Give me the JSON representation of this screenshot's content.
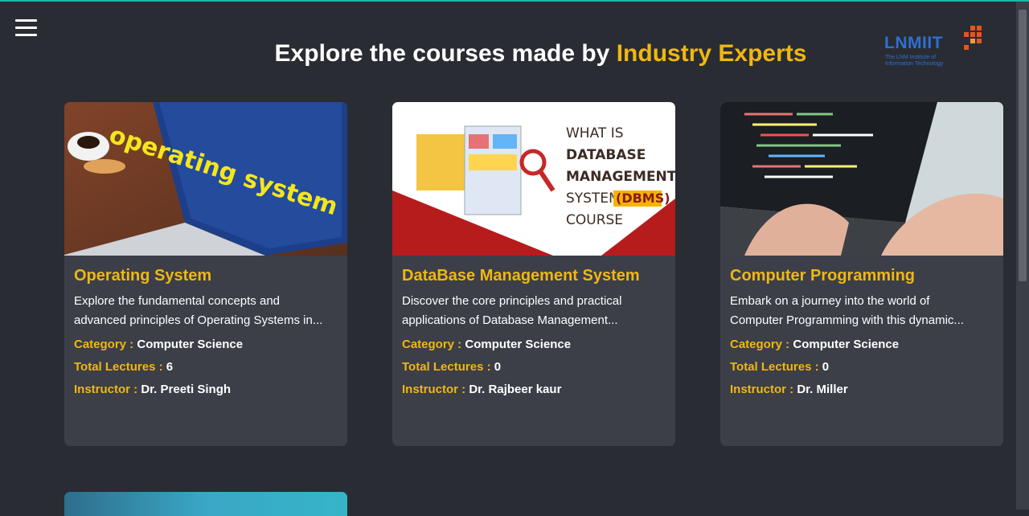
{
  "header": {
    "title_prefix": "Explore the courses made by ",
    "title_highlight": "Industry Experts",
    "logo_text": "LNMIIT",
    "logo_sub_line1": "The LNM Institute of",
    "logo_sub_line2": "Information Technology"
  },
  "labels": {
    "category": "Category : ",
    "lectures": "Total Lectures : ",
    "instructor": "Instructor : "
  },
  "image_text": {
    "os_words": "operating system",
    "dbms_line1": "WHAT IS",
    "dbms_line2": "DATABASE",
    "dbms_line3": "MANAGEMENT",
    "dbms_line4": "SYSTEM",
    "dbms_line4b": "(DBMS)",
    "dbms_line5": "COURSE"
  },
  "courses": [
    {
      "title": "Operating System",
      "desc1": "Explore the fundamental concepts and",
      "desc2": "advanced principles of Operating Systems in...",
      "category": "Computer Science",
      "lectures": "6",
      "instructor": "Dr. Preeti Singh"
    },
    {
      "title": "DataBase Management System",
      "desc1": "Discover the core principles and practical",
      "desc2": "applications of Database Management...",
      "category": "Computer Science",
      "lectures": "0",
      "instructor": "Dr. Rajbeer kaur"
    },
    {
      "title": "Computer Programming",
      "desc1": "Embark on a journey into the world of",
      "desc2": "Computer Programming with this dynamic...",
      "category": "Computer Science",
      "lectures": "0",
      "instructor": "Dr. Miller"
    }
  ],
  "colors": {
    "accent": "#f0b712",
    "background": "#292c33",
    "card": "#3c3e48"
  }
}
